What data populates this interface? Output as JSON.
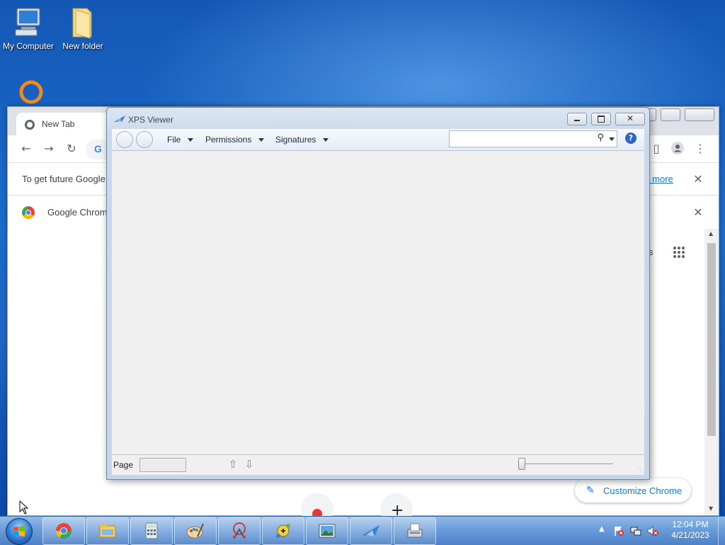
{
  "desktop": {
    "icons": [
      {
        "label": "My Computer",
        "icon": "computer-icon"
      },
      {
        "label": "New folder",
        "icon": "folder-icon"
      },
      {
        "label": "",
        "icon": "vlc-icon"
      }
    ]
  },
  "chrome": {
    "tab_title": "New Tab",
    "infobar_text": "To get future Google",
    "infobar_link": "rn more",
    "infobar2_text": "Google Chrom",
    "apps_label": "s",
    "customize_label": "Customize Chrome",
    "omnibox_letter": "G"
  },
  "xps": {
    "title": "XPS Viewer",
    "menus": [
      "File",
      "Permissions",
      "Signatures"
    ],
    "search_value": "",
    "help_label": "?",
    "page_label": "Page",
    "page_value": ""
  },
  "taskbar": {
    "apps": [
      "chrome-icon",
      "explorer-icon",
      "calculator-icon",
      "paint-icon",
      "snipping-tool-icon",
      "math-input-icon",
      "photo-viewer-icon",
      "xps-viewer-icon",
      "fax-scan-icon"
    ],
    "time": "12:04 PM",
    "date": "4/21/2023"
  },
  "colors": {
    "desktop_blue": "#1b6ccc",
    "chrome_link": "#1a73e8",
    "xps_frame": "#c9d8ea"
  }
}
